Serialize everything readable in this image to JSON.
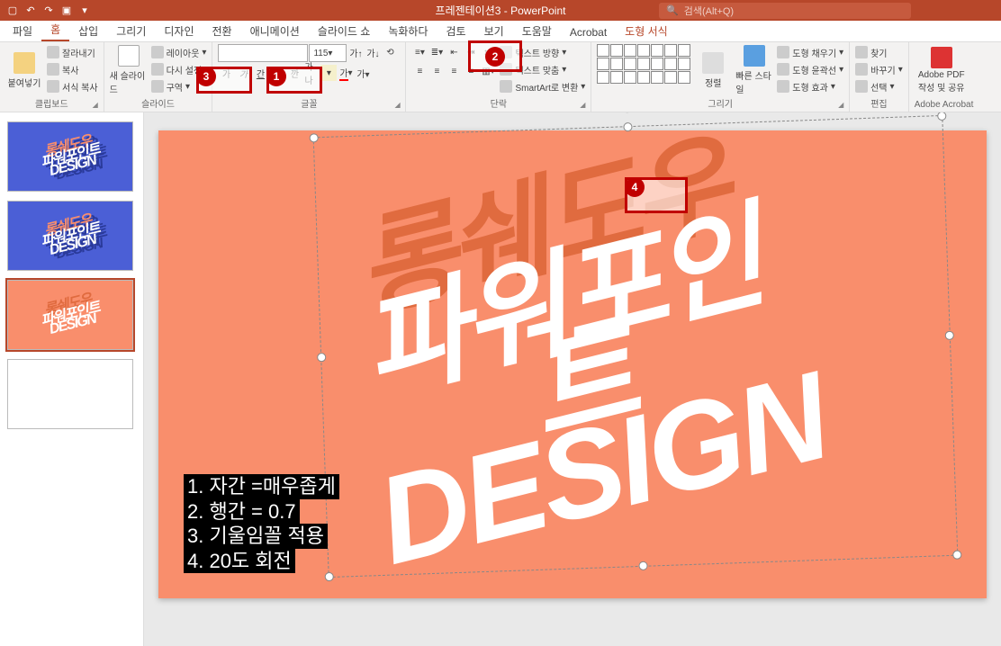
{
  "titlebar": {
    "title": "프레젠테이션3 - PowerPoint",
    "search_placeholder": "검색(Alt+Q)"
  },
  "tabs": {
    "file": "파일",
    "home": "홈",
    "insert": "삽입",
    "draw": "그리기",
    "design": "디자인",
    "transitions": "전환",
    "animations": "애니메이션",
    "slideshow": "슬라이드 쇼",
    "record": "녹화하다",
    "review": "검토",
    "view": "보기",
    "help": "도움말",
    "acrobat": "Acrobat",
    "shape_format": "도형 서식"
  },
  "ribbon": {
    "clipboard": {
      "label": "클립보드",
      "paste": "붙여넣기",
      "cut": "잘라내기",
      "copy": "복사",
      "format_painter": "서식 복사"
    },
    "slides": {
      "label": "슬라이드",
      "new_slide": "새 슬라이드",
      "layout": "레이아웃",
      "reset": "다시 설정",
      "section": "구역"
    },
    "font": {
      "label": "글꼴",
      "size": "115",
      "k_bold": "가",
      "k_italic": "가",
      "k_char": "가나"
    },
    "paragraph": {
      "label": "단락",
      "text_dir": "텍스트 방향",
      "align_text": "텍스트 맞춤",
      "smartart": "SmartArt로 변환"
    },
    "drawing": {
      "label": "그리기",
      "arrange": "정렬",
      "quick_styles": "빠른 스타일",
      "fill": "도형 채우기",
      "outline": "도형 윤곽선",
      "effects": "도형 효과"
    },
    "editing": {
      "label": "편집",
      "find": "찾기",
      "replace": "바꾸기",
      "select": "선택"
    },
    "acrobat": {
      "label": "Adobe Acrobat",
      "create_share": "Adobe PDF\n작성 및 공유"
    }
  },
  "callouts": {
    "c1": "1",
    "c2": "2",
    "c3": "3",
    "c4": "4"
  },
  "slide_text": {
    "line1": "롱쉐도우",
    "line2": "파워포인트",
    "line3": "DESIGN"
  },
  "notes": {
    "n1": "1. 자간 =매우좁게",
    "n2": "2. 행간 = 0.7",
    "n3": "3. 기울임꼴 적용",
    "n4": "4. 20도 회전"
  }
}
